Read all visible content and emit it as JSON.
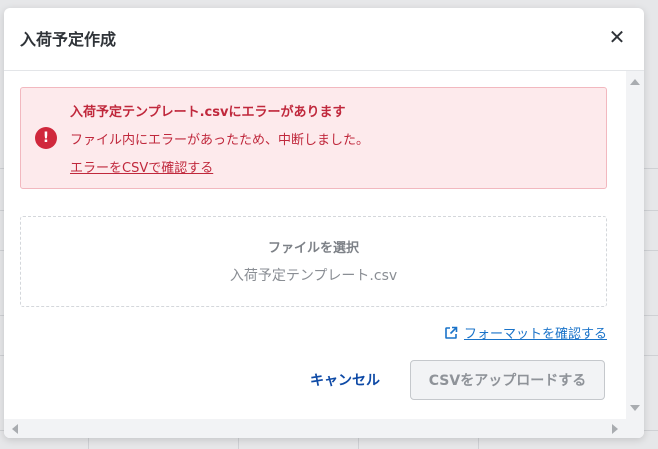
{
  "modal": {
    "title": "入荷予定作成",
    "close_glyph": "✕"
  },
  "alert": {
    "icon": "!",
    "title": "入荷予定テンプレート.csvにエラーがあります",
    "message": "ファイル内にエラーがあったため、中断しました。",
    "link": "エラーをCSVで確認する"
  },
  "dropzone": {
    "label": "ファイルを選択",
    "filename": "入荷予定テンプレート.csv"
  },
  "format_link": "フォーマットを確認する",
  "buttons": {
    "cancel": "キャンセル",
    "upload": "CSVをアップロードする"
  },
  "colors": {
    "error": "#c0283c",
    "error_bg": "#fdeaec",
    "link": "#1a73c9",
    "primary_text": "#0e4aa6"
  },
  "icons": {
    "close": "close-icon",
    "error": "error-circle-icon",
    "external_link": "external-link-icon"
  }
}
